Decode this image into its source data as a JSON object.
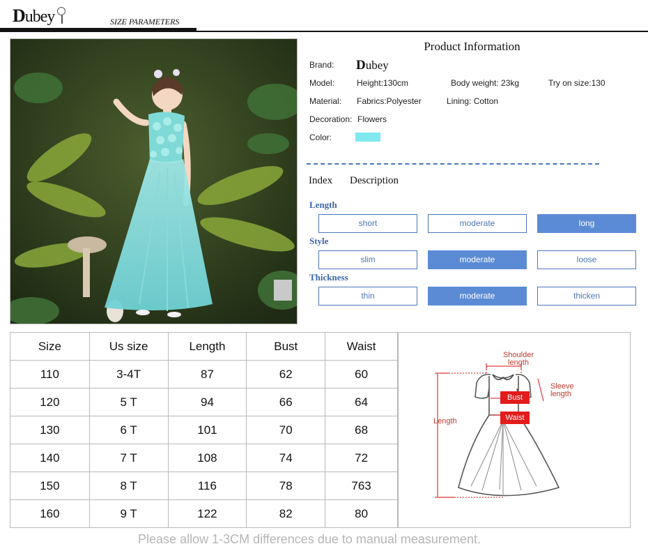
{
  "header": {
    "logo_initial": "D",
    "logo_rest": "ubey",
    "subtitle": "SIZE   PARAMETERS"
  },
  "photo": {
    "icon": "girl-in-dress-photo"
  },
  "product_info": {
    "title": "Product  Information",
    "brand_label": "Brand:",
    "brand_initial": "D",
    "brand_rest": "ubey",
    "model_label": "Model:",
    "height": "Height:130cm",
    "body_weight": "Body weight: 23kg",
    "try_on": "Try on size:130",
    "material_label": "Material:",
    "fabrics": "Fabrics:Polyester",
    "lining": "Lining: Cotton",
    "decoration_label": "Decoration:",
    "decoration": "Flowers",
    "color_label": "Color:",
    "color_swatch": "#7fe8f0"
  },
  "index": {
    "title": "Index",
    "description": "Description",
    "accent_color": "#5b8bd5",
    "categories": [
      {
        "label": "Length",
        "options": [
          "short",
          "moderate",
          "long"
        ],
        "selected": "long"
      },
      {
        "label": "Style",
        "options": [
          "slim",
          "moderate",
          "loose"
        ],
        "selected": "moderate"
      },
      {
        "label": "Thickness",
        "options": [
          "thin",
          "moderate",
          "thicken"
        ],
        "selected": "moderate"
      }
    ]
  },
  "size_table": {
    "headers": [
      "Size",
      "Us size",
      "Length",
      "Bust",
      "Waist"
    ],
    "rows": [
      [
        "110",
        "3-4T",
        "87",
        "62",
        "60"
      ],
      [
        "120",
        "5 T",
        "94",
        "66",
        "64"
      ],
      [
        "130",
        "6 T",
        "101",
        "70",
        "68"
      ],
      [
        "140",
        "7 T",
        "108",
        "74",
        "72"
      ],
      [
        "150",
        "8 T",
        "116",
        "78",
        "763"
      ],
      [
        "160",
        "9 T",
        "122",
        "82",
        "80"
      ]
    ]
  },
  "diagram": {
    "shoulder": "Shoulder length",
    "sleeve": "Sleeve length",
    "length": "Length",
    "bust": "Bust",
    "waist": "Waist",
    "accent": "#e31b1b"
  },
  "footer": {
    "note": "Please allow 1-3CM differences due to manual measurement."
  }
}
